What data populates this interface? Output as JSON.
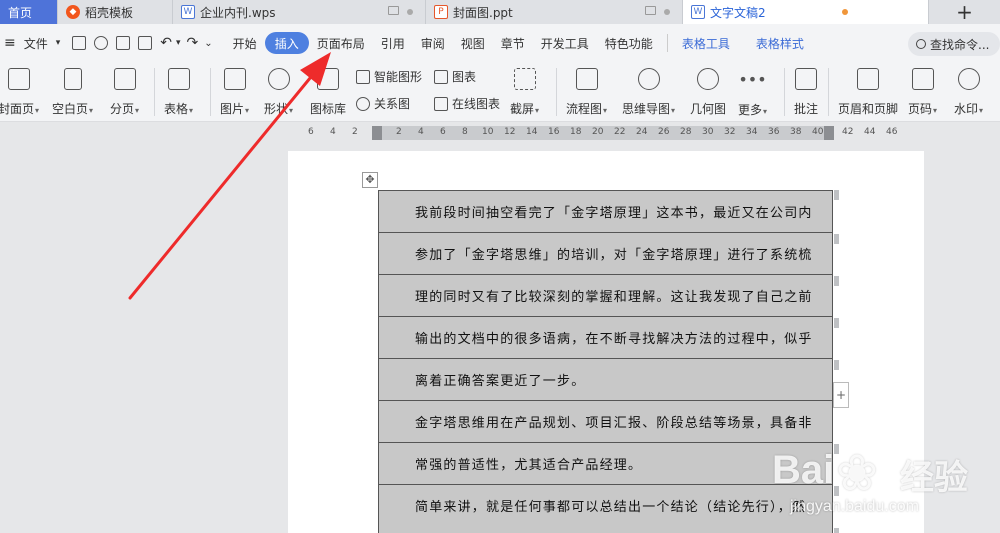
{
  "tabs": [
    {
      "label": "首页"
    },
    {
      "label": "稻壳模板"
    },
    {
      "label": "企业内刊.wps"
    },
    {
      "label": "封面图.ppt"
    },
    {
      "label": "文字文稿2"
    }
  ],
  "new_tab_symbol": "+",
  "menu": {
    "file": "文件",
    "items": [
      "开始",
      "插入",
      "页面布局",
      "引用",
      "审阅",
      "视图",
      "章节",
      "开发工具",
      "特色功能"
    ],
    "active": "插入",
    "context_items": [
      "表格工具",
      "表格样式"
    ],
    "search_placeholder": "查找命令..."
  },
  "toolbar": {
    "cover": "封面页",
    "blank": "空白页",
    "page_break": "分页",
    "table": "表格",
    "picture": "图片",
    "shape": "形状",
    "icon_lib": "图标库",
    "smart_art": "智能图形",
    "relation": "关系图",
    "chart": "图表",
    "online_chart": "在线图表",
    "screenshot": "截屏",
    "flowchart": "流程图",
    "mindmap": "思维导图",
    "geometry": "几何图",
    "more": "更多",
    "comment": "批注",
    "header_footer": "页眉和页脚",
    "page_number": "页码",
    "watermark": "水印"
  },
  "ruler_numbers": [
    "6",
    "4",
    "2",
    "2",
    "4",
    "6",
    "8",
    "10",
    "12",
    "14",
    "16",
    "18",
    "20",
    "22",
    "24",
    "26",
    "28",
    "30",
    "32",
    "34",
    "36",
    "38",
    "40",
    "42",
    "44",
    "46"
  ],
  "document": {
    "rows": [
      "我前段时间抽空看完了「金字塔原理」这本书，最近又在公司内",
      "参加了「金字塔思维」的培训，对「金字塔原理」进行了系统梳",
      "理的同时又有了比较深刻的掌握和理解。这让我发现了自己之前",
      "输出的文档中的很多语病，在不断寻找解决方法的过程中，似乎",
      "离着正确答案更近了一步。",
      "金字塔思维用在产品规划、项目汇报、阶段总结等场景，具备非",
      "常强的普适性，尤其适合产品经理。",
      "简单来讲，就是任何事都可以总结出一个结论（结论先行），然"
    ],
    "table_move_symbol": "✥",
    "add_row_symbol": "+"
  },
  "watermark": {
    "brand": "Bai",
    "brand2": "经验",
    "url": "jingyan.baidu.com"
  },
  "colors": {
    "accent": "#4e80e0",
    "annotation_arrow": "#ee2b2b",
    "table_fill": "#c8c8c8"
  }
}
